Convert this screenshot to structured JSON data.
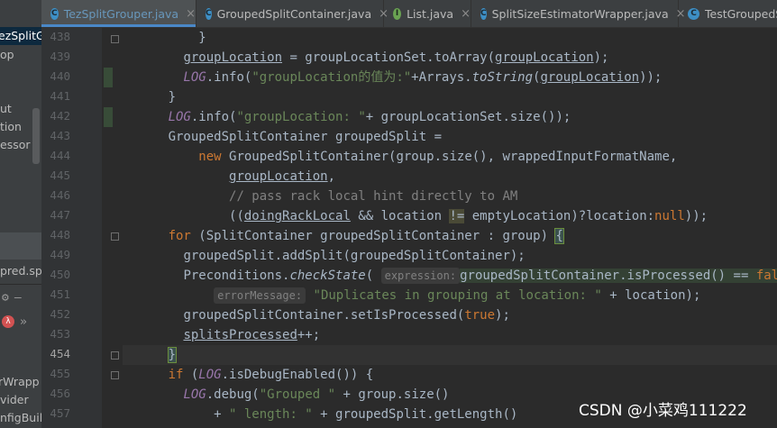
{
  "sidebar": {
    "items": [
      "ezSplitGr",
      "op",
      "ut",
      "tion",
      "essor",
      "pred.sp",
      "rWrapp",
      "vider",
      "nfigBuild"
    ],
    "panel_tab_label": "»"
  },
  "tabs": [
    {
      "label": "TezSplitGrouper.java",
      "icon": "C",
      "active": true
    },
    {
      "label": "GroupedSplitContainer.java",
      "icon": "C",
      "active": false
    },
    {
      "label": "List.java",
      "icon": "I",
      "active": false
    },
    {
      "label": "SplitSizeEstimatorWrapper.java",
      "icon": "C",
      "active": false
    },
    {
      "label": "TestGroupedS",
      "icon": "C",
      "active": false
    }
  ],
  "close_glyph": "×",
  "editor": {
    "line_numbers": [
      "438",
      "439",
      "440",
      "441",
      "442",
      "443",
      "444",
      "445",
      "446",
      "447",
      "448",
      "449",
      "450",
      "451",
      "452",
      "453",
      "454",
      "455",
      "456",
      "457"
    ],
    "lines": {
      "l438": {
        "t1": "}"
      },
      "l439": {
        "t1": "groupLocation",
        "t2": " = groupLocationSet.toArray(",
        "t3": "groupLocation",
        "t4": ");"
      },
      "l440": {
        "t1": "LOG",
        "t2": ".info(",
        "t3": "\"groupLocation的值为:\"",
        "t4": "+Arrays.",
        "t5": "toString",
        "t6": "(",
        "t7": "groupLocation",
        "t8": "));"
      },
      "l441": {
        "t1": "}"
      },
      "l442": {
        "t1": "LOG",
        "t2": ".info(",
        "t3": "\"groupLocation: \"",
        "t4": "+ groupLocationSet.size());"
      },
      "l443": {
        "t1": "GroupedSplitContainer groupedSplit ="
      },
      "l444": {
        "t1": "new",
        "t2": " GroupedSplitContainer(group.size(), wrappedInputFormatName,"
      },
      "l445": {
        "t1": "groupLocation",
        "t2": ","
      },
      "l446": {
        "t1": "// pass rack local hint directly to AM"
      },
      "l447": {
        "t1": "((",
        "t2": "doingRackLocal",
        "t3": " && location ",
        "t4": "!=",
        "t5": " emptyLocation)?location:",
        "t6": "null",
        "t7": "));"
      },
      "l448": {
        "t1": "for",
        "t2": " (SplitContainer groupedSplitContainer : group) ",
        "t3": "{"
      },
      "l449": {
        "t1": "groupedSplit.addSplit(groupedSplitContainer);"
      },
      "l450": {
        "t1": "Preconditions.",
        "t2": "checkState",
        "t3": "( ",
        "t4": "expression:",
        "t5": "groupedSplitContainer.isProcessed() == ",
        "t6": "false",
        "t7": ","
      },
      "l451": {
        "t1": "errorMessage:",
        "t2": " ",
        "t3": "\"Duplicates in grouping at location: \"",
        "t4": " + location);"
      },
      "l452": {
        "t1": "groupedSplitContainer.setIsProcessed(",
        "t2": "true",
        "t3": ");"
      },
      "l453": {
        "t1": "splitsProcessed",
        "t2": "++;"
      },
      "l454": {
        "t1": "}"
      },
      "l455": {
        "t1": "if",
        "t2": " (",
        "t3": "LOG",
        "t4": ".isDebugEnabled()) {"
      },
      "l456": {
        "t1": "LOG",
        "t2": ".debug(",
        "t3": "\"Grouped \"",
        "t4": " + group.size()"
      },
      "l457": {
        "t1": "+ ",
        "t2": "\" length: \"",
        "t3": " + groupedSplit.getLength()"
      }
    }
  },
  "watermark": "CSDN @小菜鸡111222",
  "colors": {
    "background": "#2b2b2b",
    "keyword": "#cc7832",
    "field": "#9876aa",
    "string": "#6a8759",
    "comment": "#808080",
    "text": "#a9b7c6",
    "tab_accent": "#4a88c7"
  }
}
